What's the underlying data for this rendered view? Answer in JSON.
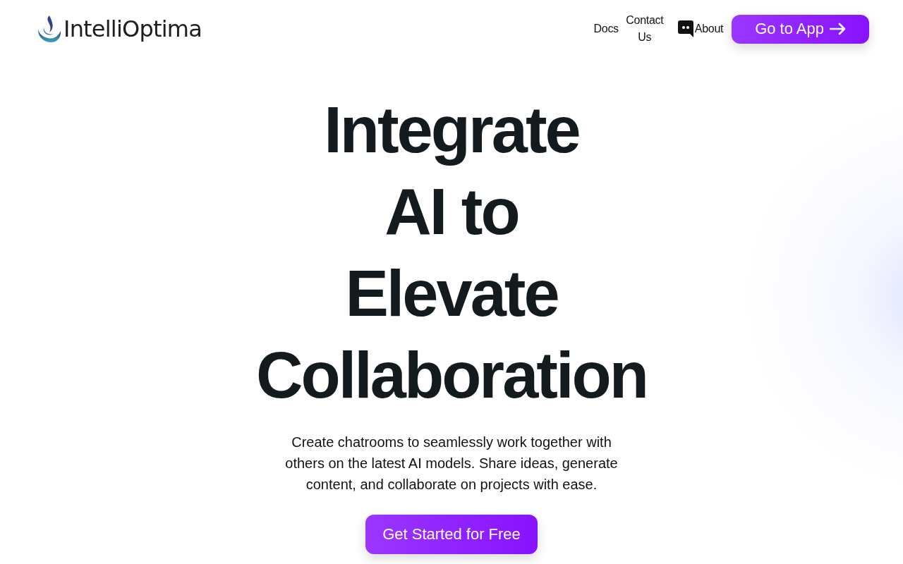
{
  "header": {
    "logo_text": "IntelliOptima",
    "nav": [
      {
        "label": "Docs",
        "kind": "text"
      },
      {
        "label": "Contact Us",
        "kind": "text"
      },
      {
        "label": "About",
        "kind": "icon"
      }
    ],
    "cta": "Go to App"
  },
  "hero": {
    "headline": [
      "Integrate",
      "AI to",
      "Elevate",
      "Collaboration"
    ],
    "description": "Create chatrooms to seamlessly work together with others on the latest AI models. Share ideas, generate content, and collaborate on projects with ease.",
    "button": "Get Started for Free"
  }
}
